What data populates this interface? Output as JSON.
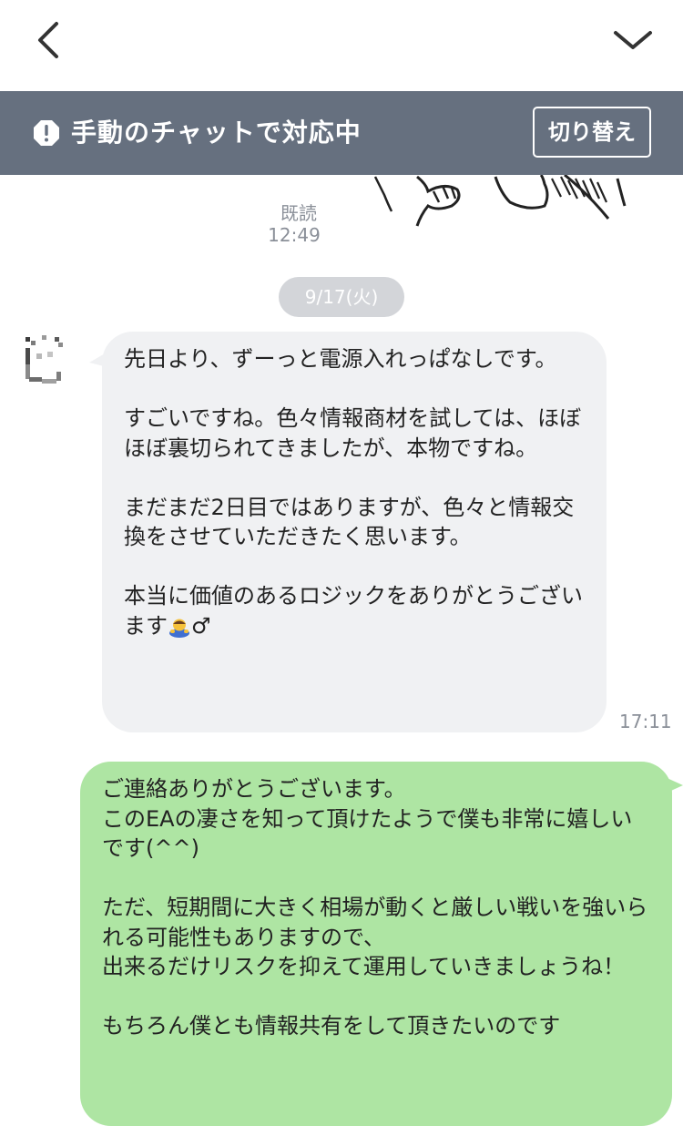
{
  "status_banner": {
    "text": "手動のチャットで対応中",
    "switch_label": "切り替え"
  },
  "previous": {
    "read_label": "既読",
    "time": "12:49"
  },
  "date_divider": "9/17(火)",
  "incoming_message": {
    "paragraphs": [
      "先日より、ずーっと電源入れっぱなしです。",
      "すごいですね。色々情報商材を試しては、ほぼほぼ裏切られてきましたが、本物ですね。",
      "まだまだ2日目ではありますが、色々と情報交換をさせていただきたく思います。",
      "本当に価値のあるロジックをありがとうございます"
    ],
    "emoji_trailer": "♂",
    "time": "17:11"
  },
  "outgoing_message": {
    "lines": [
      "ご連絡ありがとうございます。",
      "このEAの凄さを知って頂けたようで僕も非常に嬉しいです(^^)",
      "",
      "ただ、短期間に大きく相場が動くと厳しい戦いを強いられる可能性もありますので、",
      "出来るだけリスクを抑えて運用していきましょうね！",
      "",
      "もちろん僕とも情報共有をして頂きたいのです"
    ]
  },
  "colors": {
    "banner_bg": "#66707f",
    "incoming_bubble": "#f0f1f3",
    "outgoing_bubble": "#aee5a3",
    "meta_text": "#8a8f98"
  },
  "icons": {
    "back": "chevron-left-icon",
    "menu": "chevron-down-icon",
    "banner": "exclamation-icon"
  }
}
